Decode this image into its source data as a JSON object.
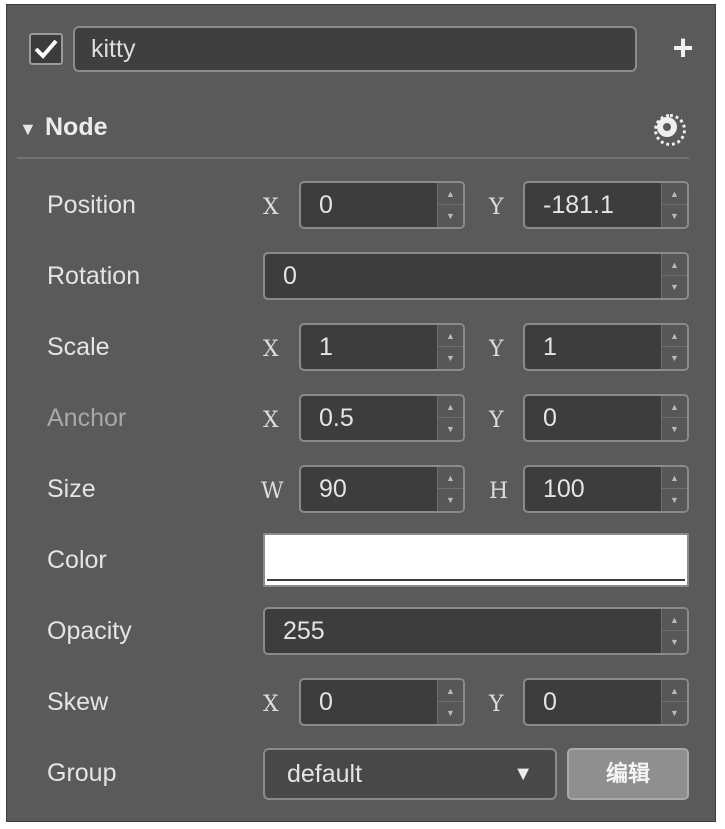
{
  "header": {
    "enabled": true,
    "node_name": "kitty",
    "add_button": "+"
  },
  "section": {
    "title": "Node",
    "collapse_arrow": "▼"
  },
  "properties": {
    "position": {
      "label": "Position",
      "x_axis": "X",
      "x": "0",
      "y_axis": "Y",
      "y": "-181.1"
    },
    "rotation": {
      "label": "Rotation",
      "value": "0"
    },
    "scale": {
      "label": "Scale",
      "x_axis": "X",
      "x": "1",
      "y_axis": "Y",
      "y": "1"
    },
    "anchor": {
      "label": "Anchor",
      "x_axis": "X",
      "x": "0.5",
      "y_axis": "Y",
      "y": "0"
    },
    "size": {
      "label": "Size",
      "w_axis": "W",
      "w": "90",
      "h_axis": "H",
      "h": "100"
    },
    "color": {
      "label": "Color",
      "value": "#ffffff"
    },
    "opacity": {
      "label": "Opacity",
      "value": "255"
    },
    "skew": {
      "label": "Skew",
      "x_axis": "X",
      "x": "0",
      "y_axis": "Y",
      "y": "0"
    },
    "group": {
      "label": "Group",
      "value": "default",
      "caret": "▼",
      "edit_button": "编辑"
    }
  },
  "icons": {
    "checkbox": "check-icon",
    "settings": "gear-icon",
    "spinner_up": "▲",
    "spinner_down": "▼"
  }
}
